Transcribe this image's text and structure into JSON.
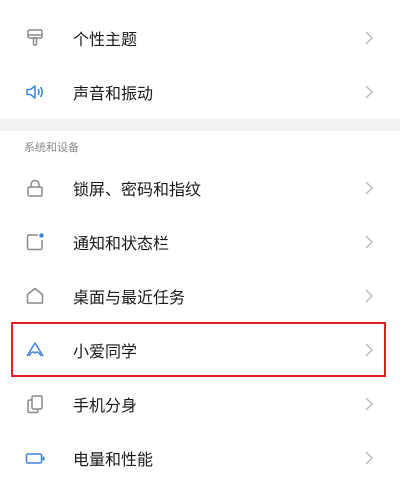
{
  "settings_top": {
    "items": [
      {
        "label": "个性主题",
        "icon": "theme-brush-icon"
      },
      {
        "label": "声音和振动",
        "icon": "speaker-icon"
      }
    ]
  },
  "section": {
    "title": "系统和设备"
  },
  "settings_system": {
    "items": [
      {
        "label": "锁屏、密码和指纹",
        "icon": "lock-icon"
      },
      {
        "label": "通知和状态栏",
        "icon": "notification-icon"
      },
      {
        "label": "桌面与最近任务",
        "icon": "home-icon"
      },
      {
        "label": "小爱同学",
        "icon": "xiaoai-assistant-icon"
      },
      {
        "label": "手机分身",
        "icon": "dual-phone-icon"
      },
      {
        "label": "电量和性能",
        "icon": "battery-icon"
      }
    ]
  },
  "colors": {
    "icon_gray": "#8a8a8a",
    "icon_blue": "#3f82e0",
    "chevron": "#bdbdbd",
    "highlight_border": "#e02020"
  }
}
